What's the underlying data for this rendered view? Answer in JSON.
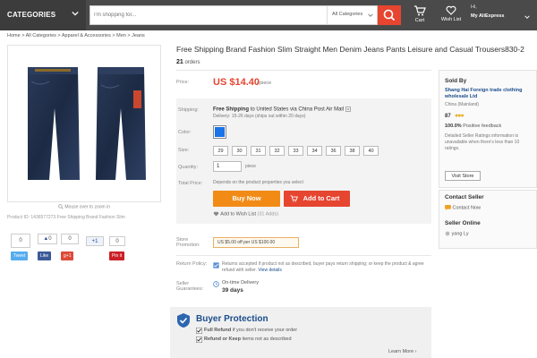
{
  "header": {
    "categories_label": "CATEGORIES",
    "search_placeholder": "I'm shopping for...",
    "search_category": "All Categories",
    "cart_label": "Cart",
    "wishlist_label": "Wish List",
    "account_hi": "Hi,",
    "account_label": "My AliExpress"
  },
  "breadcrumb": "Home > All Categories > Apparel & Accessories > Men > Jeans",
  "gallery": {
    "zoom_hint": "Mouse over to zoom in",
    "product_id": "Product ID: 1436577273 Free Shipping Brand Fashion Slim"
  },
  "social": {
    "counts": [
      "0",
      "0",
      "+1",
      "0"
    ],
    "buttons": [
      "Tweet",
      "Like",
      "g+1",
      "Pin it"
    ],
    "like_count": "0"
  },
  "product": {
    "title": "Free Shipping Brand Fashion Slim Straight Men Denim Jeans Pants Leisure and Casual Trousers830-2",
    "orders_count": "21",
    "orders_label": "orders",
    "price_label": "Price:",
    "price": "US $14.40",
    "per_unit": "/ piece",
    "shipping_label": "Shipping:",
    "shipping_free": "Free Shipping",
    "shipping_to": "to United States via China Post Air Mail",
    "delivery": "Delivery: 15-26 days (ships out within 20 days)",
    "color_label": "Color:",
    "color_swatch": "#1a73e8",
    "size_label": "Size:",
    "sizes": [
      "29",
      "30",
      "31",
      "32",
      "33",
      "34",
      "36",
      "38",
      "40"
    ],
    "quantity_label": "Quantity:",
    "quantity_value": "1",
    "quantity_unit": "piece",
    "total_label": "Total Price:",
    "total_text": "Depends on the product properties you select",
    "buy_now": "Buy Now",
    "add_to_cart": "Add to Cart",
    "wishlist": "Add to Wish List",
    "wishlist_adds": "(31 Adds)",
    "promo_label": "Store Promotion:",
    "promo_text": "US $5.00 off per US $100.00",
    "return_label": "Return Policy:",
    "return_text": "Returns accepted if product not as described, buyer pays return shipping; or keep the product & agree refund with seller.",
    "return_link": "View details",
    "guarantee_label": "Seller Guarantees:",
    "guarantee_title": "On-time Delivery",
    "guarantee_days": "39 days"
  },
  "seller": {
    "sold_by": "Sold By",
    "name": "Shang Hai Foreign trade clothing wholesale Ltd",
    "location": "China (Mainland)",
    "score": "87",
    "feedback_pct": "100.0%",
    "feedback_label": "Positive feedback",
    "detail_text": "Detailed Seller Ratings information is unavailable when there's less than 10 ratings.",
    "visit_store": "Visit Store",
    "contact_title": "Contact Seller",
    "contact_now": "Contact Now",
    "online_title": "Seller Online",
    "online_name": "yang Ly"
  },
  "buyer_protection": {
    "title": "Buyer Protection",
    "full_refund_bold": "Full Refund",
    "full_refund_text": "if you don't receive your order",
    "refund_keep_bold": "Refund or Keep",
    "refund_keep_text": "items not as described",
    "learn_more": "Learn More"
  },
  "colors": {
    "accent_red": "#e64530",
    "buy_orange": "#f28b16",
    "link_blue": "#1a4d8c"
  }
}
